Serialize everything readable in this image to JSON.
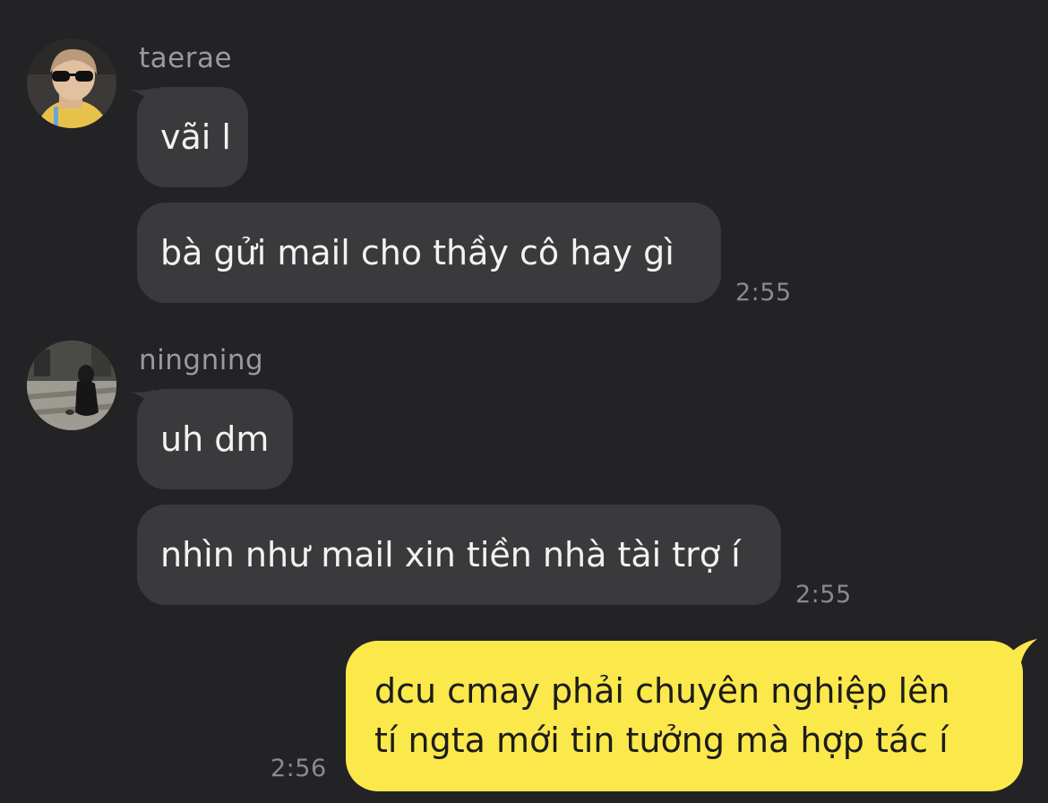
{
  "groups": [
    {
      "sender": "taerae",
      "avatar_icon": "avatar-taerae",
      "messages": [
        "vãi l",
        "bà gửi mail cho thầy cô hay gì"
      ],
      "time": "2:55"
    },
    {
      "sender": "ningning",
      "avatar_icon": "avatar-ningning",
      "messages": [
        "uh dm",
        "nhìn như mail xin tiền nhà tài trợ í"
      ],
      "time": "2:55"
    }
  ],
  "outgoing": {
    "lines": [
      "dcu cmay phải chuyên nghiệp lên",
      "tí ngta mới tin tưởng mà hợp tác í"
    ],
    "time": "2:56"
  },
  "colors": {
    "background": "#232325",
    "incoming_bubble": "#3a3a3d",
    "outgoing_bubble": "#fbe84b"
  }
}
